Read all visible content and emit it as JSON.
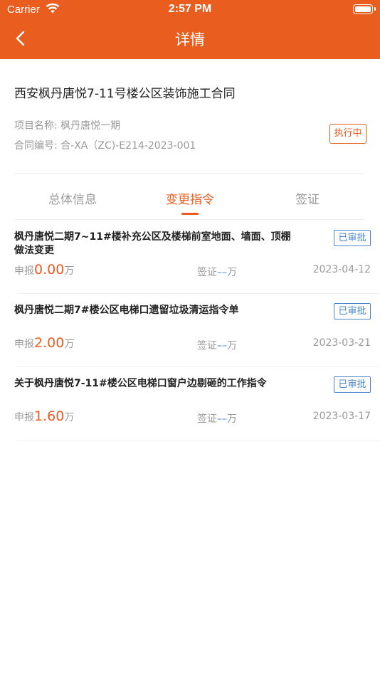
{
  "status_bar": {
    "carrier": "Carrier",
    "time": "2:57 PM"
  },
  "nav": {
    "title": "详情",
    "back_icon": "chevron-left-icon"
  },
  "contract": {
    "title": "西安枫丹唐悦7-11号楼公区装饰施工合同",
    "project_line": "项目名称: 枫丹唐悦一期",
    "code_line": "合同编号: 合-XA（ZC)-E214-2023-001",
    "status": "执行中"
  },
  "tabs": [
    {
      "label": "总体信息"
    },
    {
      "label": "变更指令"
    },
    {
      "label": "签证"
    }
  ],
  "active_tab": 1,
  "items": [
    {
      "title": "枫丹唐悦二期7~11#楼补充公区及楼梯前室地面、墙面、顶棚做法变更",
      "badge": "已审批",
      "declare_label": "申报",
      "declare_value": "0.00",
      "declare_unit": "万",
      "visa_label": "签证",
      "visa_value": "––",
      "visa_unit": "万",
      "date": "2023-04-12"
    },
    {
      "title": "枫丹唐悦二期7#楼公区电梯口遗留垃圾清运指令单",
      "badge": "已审批",
      "declare_label": "申报",
      "declare_value": "2.00",
      "declare_unit": "万",
      "visa_label": "签证",
      "visa_value": "––",
      "visa_unit": "万",
      "date": "2023-03-21"
    },
    {
      "title": "关于枫丹唐悦7-11#楼公区电梯口窗户边剔砸的工作指令",
      "badge": "已审批",
      "declare_label": "申报",
      "declare_value": "1.60",
      "declare_unit": "万",
      "visa_label": "签证",
      "visa_value": "––",
      "visa_unit": "万",
      "date": "2023-03-17"
    }
  ],
  "colors": {
    "accent": "#e95d1f",
    "approved": "#4a86c8"
  }
}
